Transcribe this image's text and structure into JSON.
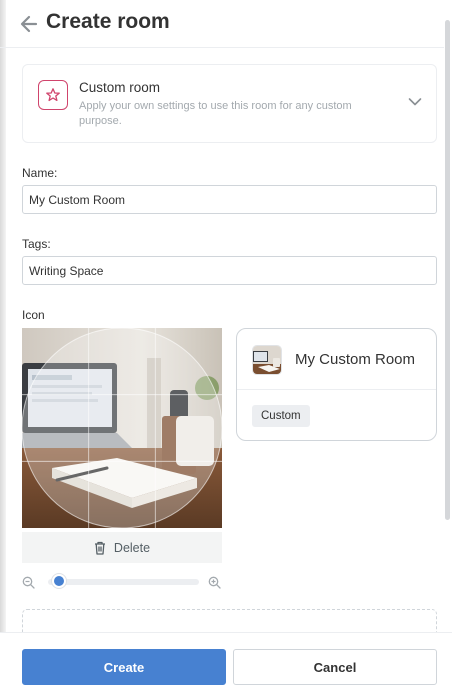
{
  "header": {
    "title": "Create room",
    "back_icon": "arrow-left-icon"
  },
  "room_type": {
    "title": "Custom room",
    "description": "Apply your own settings to use this room for any custom purpose.",
    "icon": "star-icon",
    "accent_color": "#d0446c"
  },
  "name_field": {
    "label": "Name:",
    "value": "My Custom Room"
  },
  "tags_field": {
    "label": "Tags:",
    "value": "Writing Space"
  },
  "icon_section": {
    "label": "Icon",
    "delete_label": "Delete",
    "zoom_level": 0.05
  },
  "preview": {
    "title": "My Custom Room",
    "tag": "Custom"
  },
  "footer": {
    "create_label": "Create",
    "cancel_label": "Cancel"
  },
  "colors": {
    "primary": "#4781d1",
    "border": "#d0d5da",
    "muted_text": "#a3a9ae"
  }
}
